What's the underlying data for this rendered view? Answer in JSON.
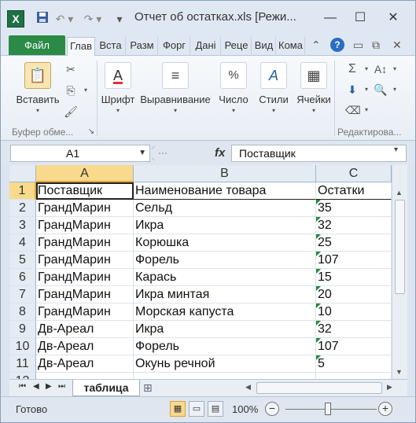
{
  "window": {
    "title": "Отчет об остатках.xls  [Режи...",
    "app_icon": "X",
    "controls": {
      "minimize": "—",
      "maximize": "☐",
      "close": "✕"
    }
  },
  "quick_access": {
    "save_icon": "save-icon",
    "undo_icon": "undo-icon",
    "redo_icon": "redo-icon"
  },
  "ribbon": {
    "file_tab": "Файл",
    "tabs": [
      "Глав",
      "Вста",
      "Разм",
      "Форг",
      "Дані",
      "Реце",
      "Вид",
      "Кома"
    ],
    "active_tab": 0,
    "groups": {
      "clipboard_label": "Буфер обме...",
      "paste_label": "Вставить",
      "font_label": "Шрифт",
      "alignment_label": "Выравнивание",
      "number_label": "Число",
      "styles_label": "Стили",
      "cells_label": "Ячейки",
      "editing_label": "Редактирова..."
    }
  },
  "formula_bar": {
    "name_box": "A1",
    "fx": "fx",
    "formula": "Поставщик"
  },
  "columns": [
    "A",
    "B",
    "C"
  ],
  "rows": [
    {
      "n": "1",
      "a": "Поставщик",
      "b": "Наименование товара",
      "c": "Остатки"
    },
    {
      "n": "2",
      "a": "ГрандМарин",
      "b": "Сельд",
      "c": "35"
    },
    {
      "n": "3",
      "a": "ГрандМарин",
      "b": "Икра",
      "c": "32"
    },
    {
      "n": "4",
      "a": "ГрандМарин",
      "b": "Корюшка",
      "c": "25"
    },
    {
      "n": "5",
      "a": "ГрандМарин",
      "b": "Форель",
      "c": "107"
    },
    {
      "n": "6",
      "a": "ГрандМарин",
      "b": "Карась",
      "c": "15"
    },
    {
      "n": "7",
      "a": "ГрандМарин",
      "b": "Икра минтая",
      "c": "20"
    },
    {
      "n": "8",
      "a": "ГрандМарин",
      "b": "Морская капуста",
      "c": "10"
    },
    {
      "n": "9",
      "a": "Дв-Ареал",
      "b": "Икра",
      "c": "32"
    },
    {
      "n": "10",
      "a": "Дв-Ареал",
      "b": "Форель",
      "c": "107"
    },
    {
      "n": "11",
      "a": "Дв-Ареал",
      "b": "Окунь речной",
      "c": "5"
    },
    {
      "n": "12",
      "a": "",
      "b": "",
      "c": ""
    }
  ],
  "sheet_tabs": {
    "active": "таблица"
  },
  "status_bar": {
    "ready": "Готово",
    "zoom": "100%"
  }
}
